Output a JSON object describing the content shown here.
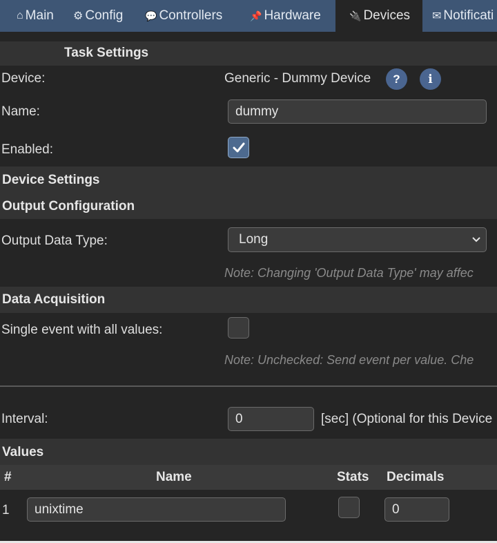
{
  "nav": {
    "tabs": [
      {
        "label": "Main",
        "icon": "house-icon",
        "glyph": "⌂"
      },
      {
        "label": "Config",
        "icon": "gear-icon",
        "glyph": "⚙"
      },
      {
        "label": "Controllers",
        "icon": "speech-bubble-icon",
        "glyph": "💬"
      },
      {
        "label": "Hardware",
        "icon": "pushpin-icon",
        "glyph": "📌"
      },
      {
        "label": "Devices",
        "icon": "plug-icon",
        "glyph": "🔌"
      },
      {
        "label": "Notificati",
        "icon": "envelope-icon",
        "glyph": "✉"
      }
    ],
    "active": "Devices"
  },
  "task": {
    "header": "Task Settings",
    "device_label": "Device:",
    "device_value": "Generic - Dummy Device",
    "help_icon": "?",
    "info_icon": "i",
    "name_label": "Name:",
    "name_value": "dummy",
    "enabled_label": "Enabled:",
    "enabled": true
  },
  "device_settings": {
    "header": "Device Settings",
    "output_header": "Output Configuration",
    "output_type_label": "Output Data Type:",
    "output_type_value": "Long",
    "output_note": "Note: Changing 'Output Data Type' may affec"
  },
  "data_acquisition": {
    "header": "Data Acquisition",
    "single_event_label": "Single event with all values:",
    "single_event": false,
    "single_event_note": "Note: Unchecked: Send event per value. Che",
    "interval_label": "Interval:",
    "interval_value": "0",
    "interval_suffix": "[sec] (Optional for this Device"
  },
  "values": {
    "header": "Values",
    "columns": [
      "#",
      "Name",
      "Stats",
      "Decimals"
    ],
    "rows": [
      {
        "index": "1",
        "name": "unixtime",
        "stats": false,
        "decimals": "0"
      }
    ]
  },
  "colors": {
    "nav_bg": "#3e5675",
    "page_bg": "#252525",
    "section_bg": "#333333",
    "accent": "#4a6590"
  }
}
